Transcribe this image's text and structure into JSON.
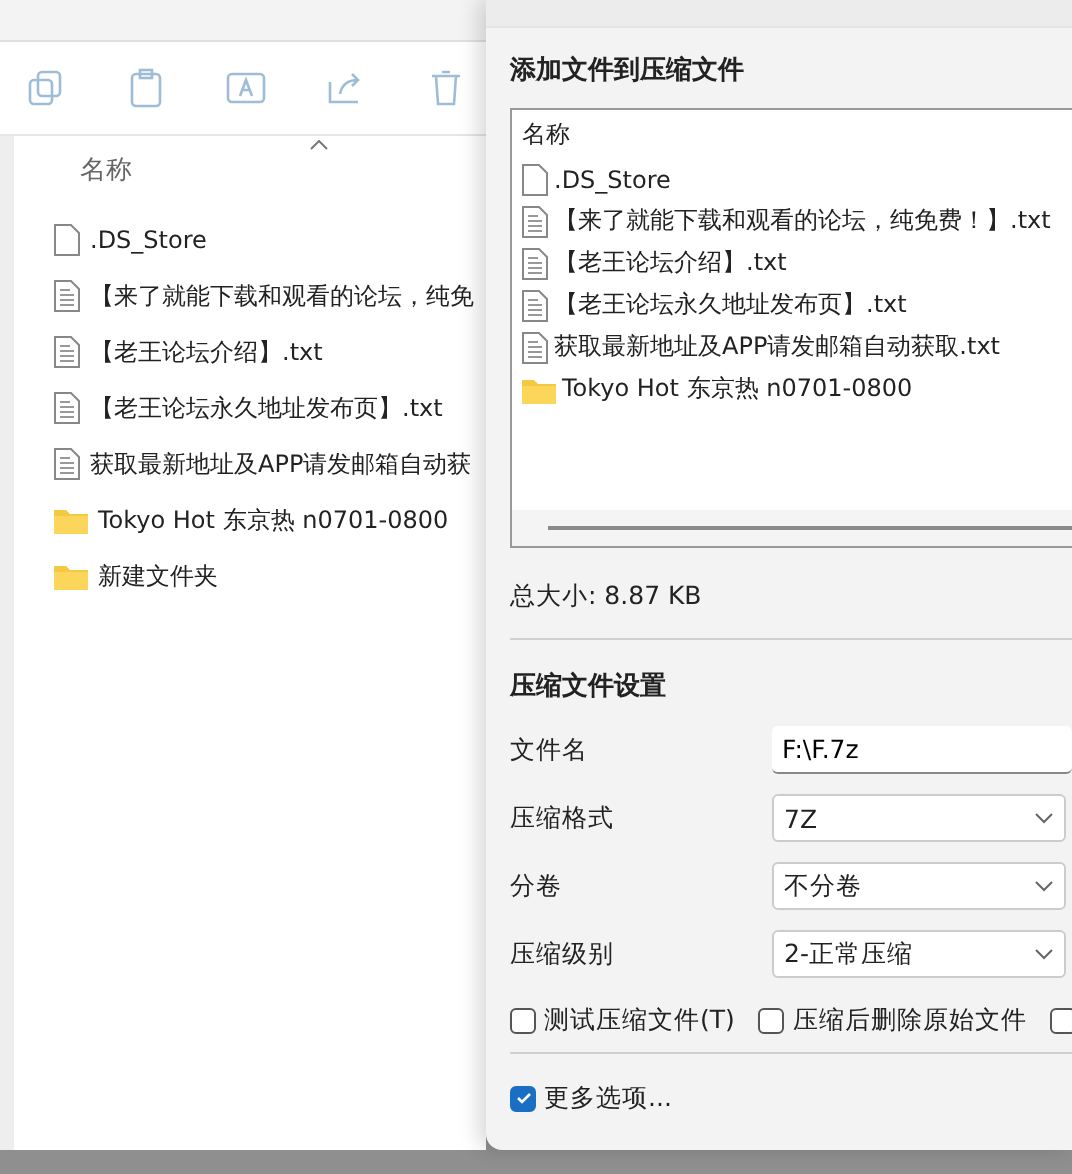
{
  "explorer": {
    "column_header": "名称",
    "files": [
      {
        "kind": "file",
        "name": ".DS_Store"
      },
      {
        "kind": "text",
        "name": "【来了就能下载和观看的论坛，纯免"
      },
      {
        "kind": "text",
        "name": "【老王论坛介绍】.txt"
      },
      {
        "kind": "text",
        "name": "【老王论坛永久地址发布页】.txt"
      },
      {
        "kind": "text",
        "name": "获取最新地址及APP请发邮箱自动获"
      },
      {
        "kind": "folder",
        "name": "Tokyo Hot 东京热 n0701-0800"
      },
      {
        "kind": "folder",
        "name": "新建文件夹"
      }
    ]
  },
  "dialog": {
    "heading": "添加文件到压缩文件",
    "list": {
      "column_header": "名称",
      "files": [
        {
          "kind": "file",
          "name": ".DS_Store"
        },
        {
          "kind": "text",
          "name": "【来了就能下载和观看的论坛，纯免费！】.txt"
        },
        {
          "kind": "text",
          "name": "【老王论坛介绍】.txt"
        },
        {
          "kind": "text",
          "name": "【老王论坛永久地址发布页】.txt"
        },
        {
          "kind": "text",
          "name": "获取最新地址及APP请发邮箱自动获取.txt"
        },
        {
          "kind": "folder",
          "name": "Tokyo Hot 东京热 n0701-0800"
        }
      ]
    },
    "total_size": "总大小: 8.87 KB",
    "settings_heading": "压缩文件设置",
    "fields": [
      {
        "kind": "input",
        "label": "文件名",
        "value": "F:\\F.7z"
      },
      {
        "kind": "select",
        "label": "压缩格式",
        "value": "7Z"
      },
      {
        "kind": "select",
        "label": "分卷",
        "value": "不分卷"
      },
      {
        "kind": "select",
        "label": "压缩级别",
        "value": "2-正常压缩"
      }
    ],
    "options": [
      {
        "label": "测试压缩文件(T)",
        "checked": false
      },
      {
        "label": "压缩后删除原始文件",
        "checked": false
      },
      {
        "checked": false
      }
    ],
    "more_options": {
      "label": "更多选项...",
      "checked": true
    }
  }
}
